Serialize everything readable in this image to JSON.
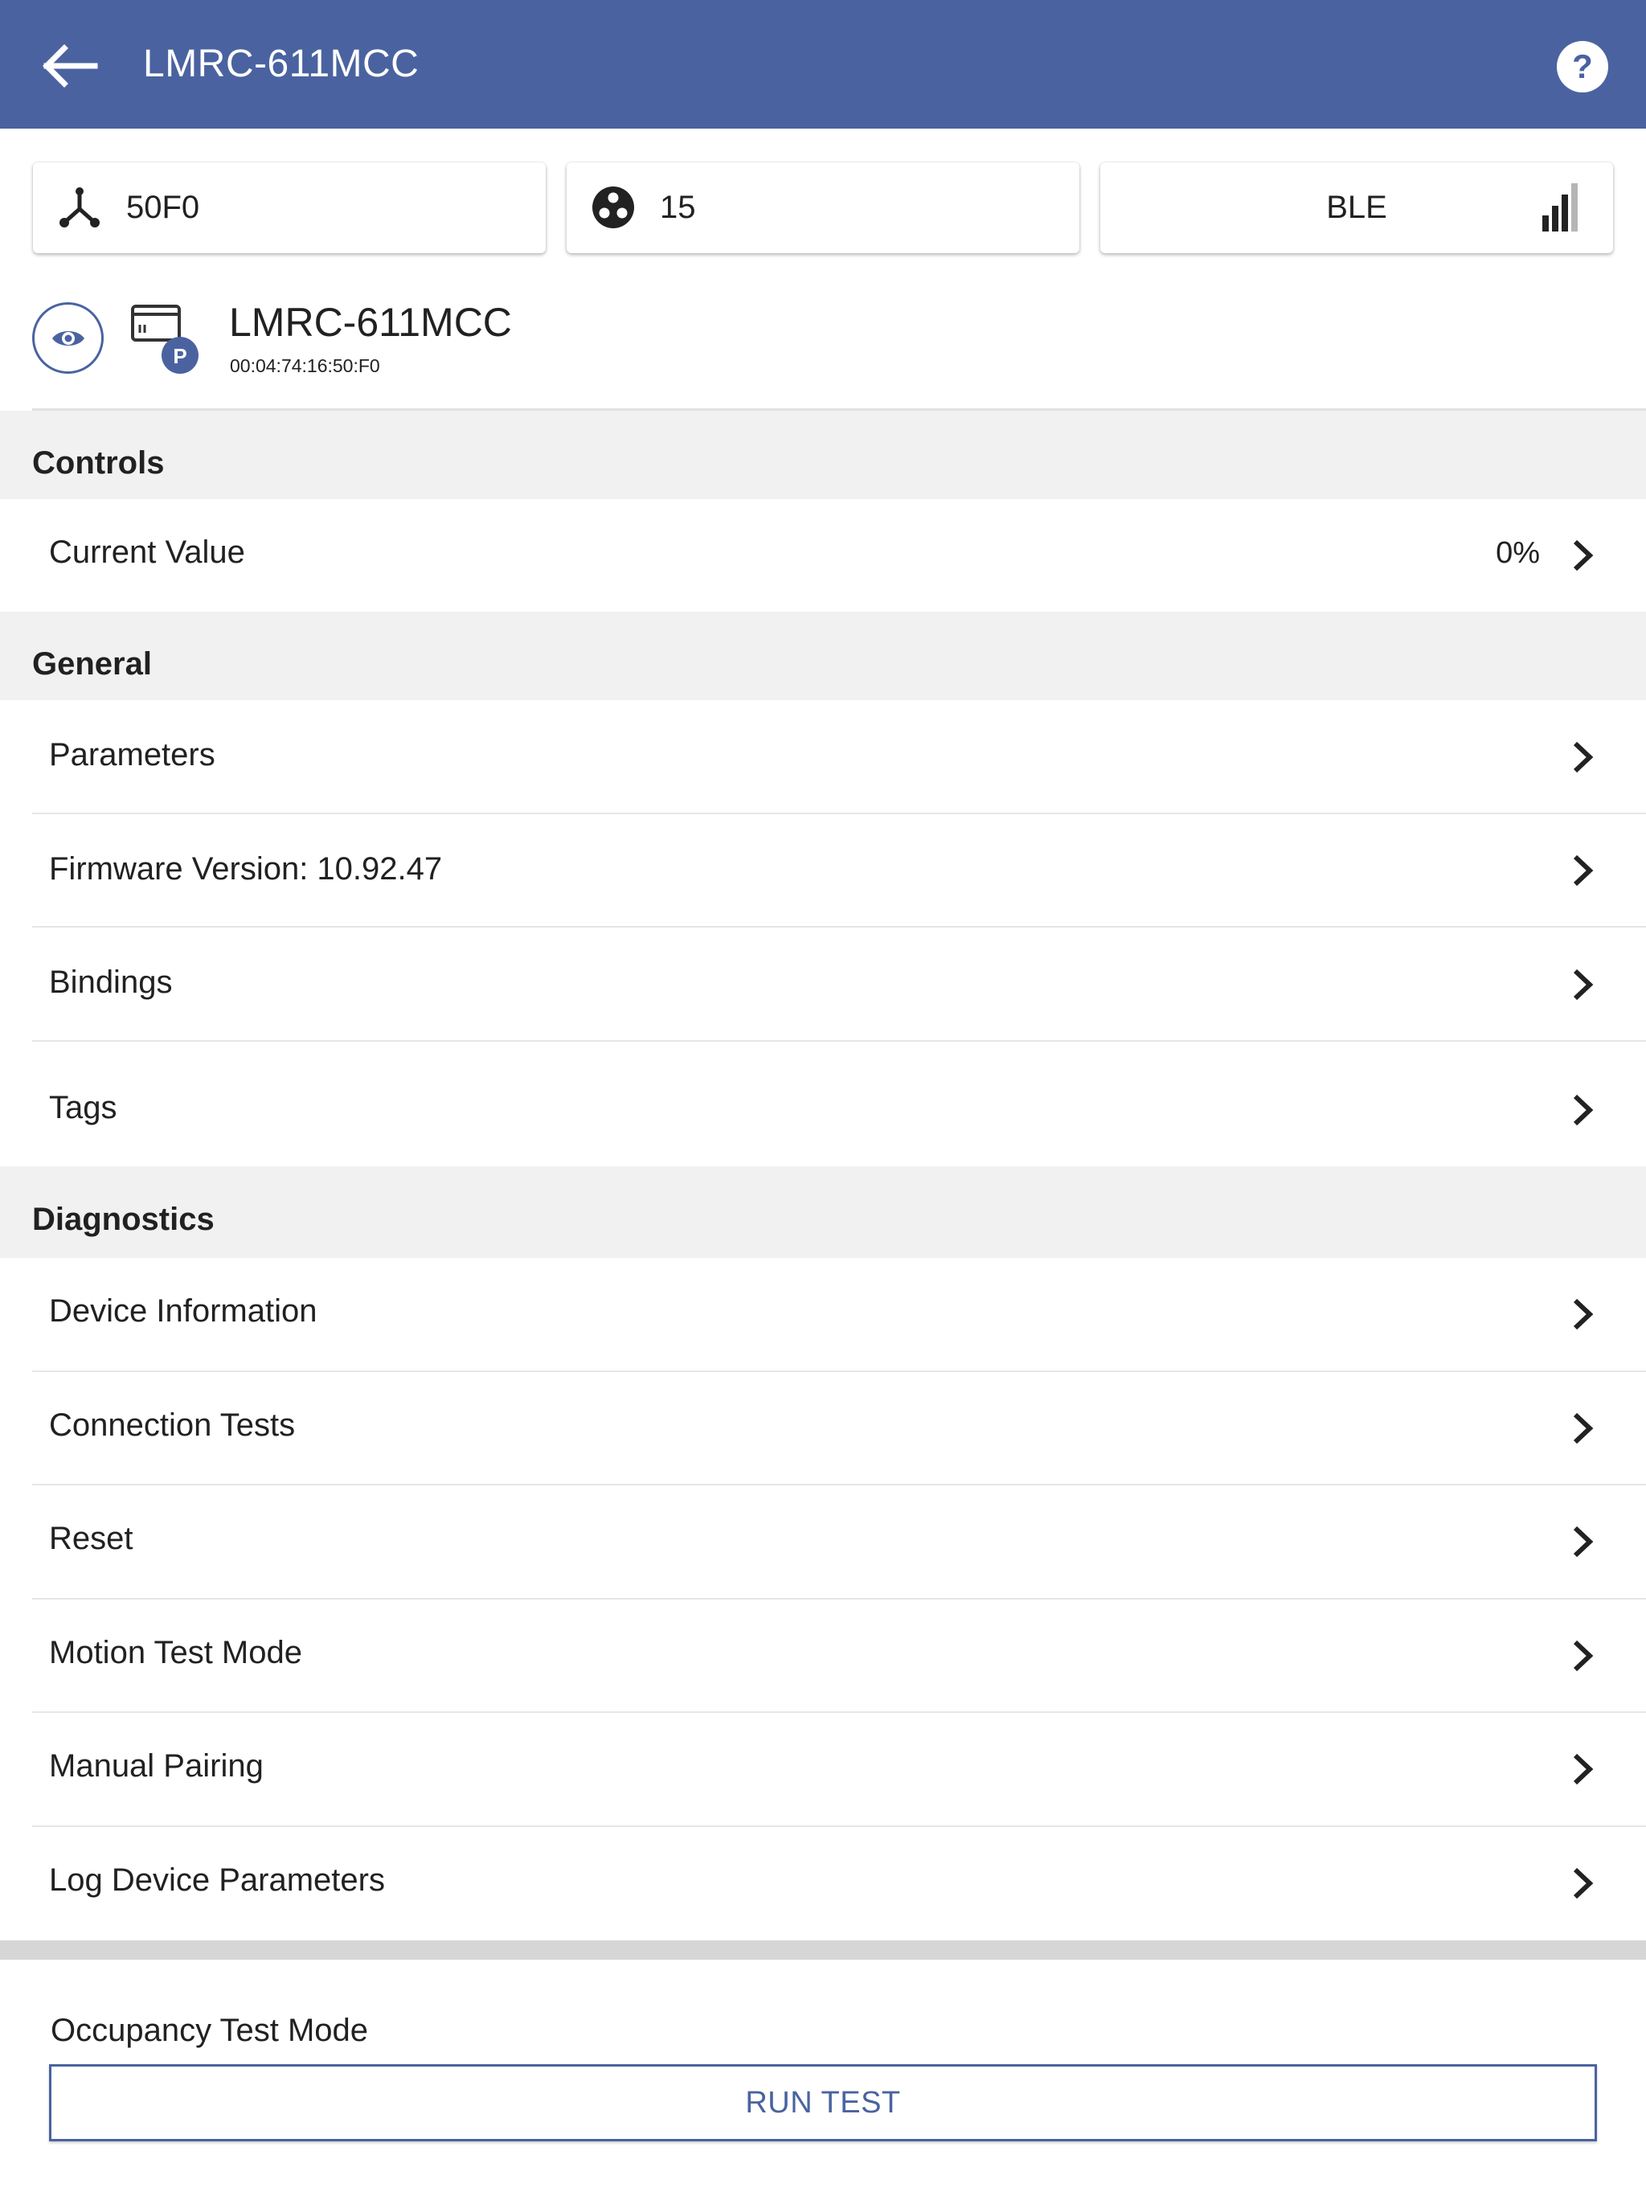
{
  "header": {
    "title": "LMRC-611MCC",
    "back_icon": "arrow-left-icon",
    "help_icon": "help-circle-icon"
  },
  "cards": {
    "network": {
      "icon": "network-hub-icon",
      "value": "50F0"
    },
    "zone": {
      "icon": "group-circle-icon",
      "value": "15"
    },
    "connection": {
      "label": "BLE",
      "icon": "signal-strength-icon",
      "signal_bars_filled": 3,
      "signal_bars_total": 4
    }
  },
  "device": {
    "name": "LMRC-611MCC",
    "mac": "00:04:74:16:50:F0",
    "badge": "P",
    "identify_icon": "eye-icon",
    "device_icon": "room-controller-icon"
  },
  "sections": {
    "controls": {
      "title": "Controls",
      "current_value": {
        "label": "Current Value",
        "value": "0%"
      }
    },
    "general": {
      "title": "General",
      "items": [
        "Parameters",
        "Firmware Version: 10.92.47",
        "Bindings",
        "Tags"
      ]
    },
    "diagnostics": {
      "title": "Diagnostics",
      "items": [
        "Device Information",
        "Connection Tests",
        "Reset",
        "Motion Test Mode",
        "Manual Pairing",
        "Log Device Parameters"
      ]
    }
  },
  "occupancy": {
    "label": "Occupancy Test Mode",
    "button": "RUN TEST"
  },
  "colors": {
    "primary": "#4a63a0",
    "section_bg": "#f0f1f0",
    "divider": "#e6e6e6"
  }
}
